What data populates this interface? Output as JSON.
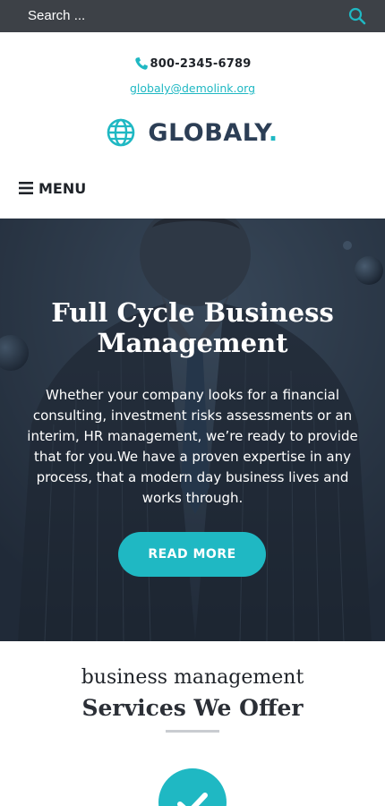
{
  "search": {
    "placeholder": "Search ...",
    "icon": "search-icon"
  },
  "contact": {
    "phone": "800-2345-6789",
    "phone_icon": "phone-icon",
    "email": "globaly@demolink.org"
  },
  "logo": {
    "name": "GLOBALY",
    "dot": ".",
    "icon": "globe-icon"
  },
  "nav": {
    "menu_label": "MENU",
    "icon": "hamburger-icon"
  },
  "hero": {
    "title": "Full Cycle Business Management",
    "text": "Whether your company looks for a financial consulting, investment risks assessments or an interim, HR management, we’re ready to provide that for you.We have a proven expertise in any process, that a modern day business lives and works through.",
    "button_label": "READ MORE"
  },
  "services": {
    "subtitle": "business management",
    "title": "Services We Offer",
    "badge_icon": "checkmark-icon"
  },
  "colors": {
    "accent": "#1fb8c3",
    "topbar": "#3d4147",
    "logo_text": "#2c3e55",
    "hero_overlay": "#2c3a4a"
  }
}
